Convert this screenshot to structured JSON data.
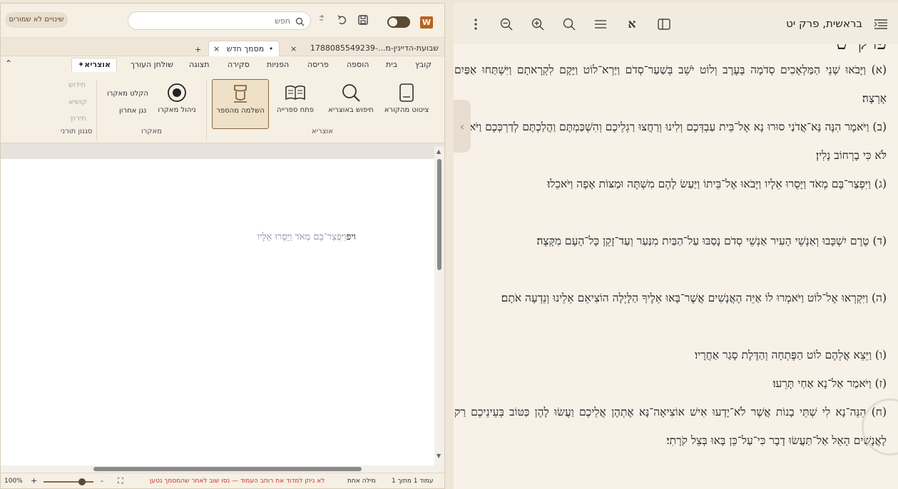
{
  "editor": {
    "unsaved_badge": "שינויים לא שמורים",
    "search_placeholder": "חפש",
    "tabs": [
      {
        "label": "שבועת-הדיינין-מ...-1788085549239"
      },
      {
        "label": "מסמך חדש",
        "dot": "•"
      }
    ],
    "tab_close": "×",
    "tab_add": "+",
    "menu": [
      "קובץ",
      "בית",
      "הוספה",
      "פריסה",
      "הפניות",
      "סקירה",
      "תצוגה",
      "שולחן העורך",
      "✦אוצריא"
    ],
    "ribbon": {
      "buttons": [
        "ציטוט מהקורא",
        "חיפוש באוצריא",
        "פתח ספרייה",
        "השלמה מהספר",
        "ניהול מאקרו"
      ],
      "small": [
        "הקלט מאקרו",
        "נגן אחרון",
        "חידוש",
        "קושיא",
        "תירוץ"
      ],
      "groups": [
        "אוצריא",
        "מאקרו",
        "סגנון תורני"
      ]
    },
    "document": {
      "typed": "ויפ",
      "suggestion": "וַיִּפְצַר־בָּם מְאֹד וַיָּסֻרוּ אֵלָיו"
    },
    "status": {
      "page": "עמוד 1 מתוך 1",
      "words": "מילה אחת",
      "warning": "לא ניתן למדוד את רוחב העמוד — נסו שוב לאחר שהמסמך נטען",
      "zoom": "100%",
      "plus": "+",
      "minus": "-"
    }
  },
  "reader": {
    "title": "בראשית, פרק יט",
    "chapter_heading": "פרק יט",
    "verses": [
      "(א) וַיָּבֹאוּ שְׁנֵי הַמַּלְאָכִים סְדֹמָה בָּעֶרֶב וְלוֹט יֹשֵׁב בְּשַׁעַר־סְדֹם וַיַּרְא־לוֹט וַיָּקָם לִקְרָאתָם וַיִּשְׁתַּחוּ אַפַּיִם אָרְצָה׃",
      "(ב) וַיֹּאמֶר הִנֶּה נָּא־אֲדֹנַי סוּרוּ נָא אֶל־בֵּית עַבְדְּכֶם וְלִינוּ וְרַחֲצוּ רַגְלֵיכֶם וְהִשְׁכַּמְתֶּם וַהֲלַכְתֶּם לְדַרְכְּכֶם וַיֹּאמְרוּ לֹּא כִּי בָרְחוֹב נָלִין׃",
      "(ג) וַיִּפְצַר־בָּם מְאֹד וַיָּסֻרוּ אֵלָיו וַיָּבֹאוּ אֶל־בֵּיתוֹ וַיַּעַשׂ לָהֶם מִשְׁתֶּה וּמַצּוֹת אָפָה וַיֹּאכֵלוּ׃",
      "(ד) טֶרֶם יִשְׁכָּבוּ וְאַנְשֵׁי הָעִיר אַנְשֵׁי סְדֹם נָסַבּוּ עַל־הַבַּיִת מִנַּעַר וְעַד־זָקֵן כָּל־הָעָם מִקָּצֶה׃",
      "(ה) וַיִּקְרְאוּ אֶל־לוֹט וַיֹּאמְרוּ לוֹ אַיֵּה הָאֲנָשִׁים אֲשֶׁר־בָּאוּ אֵלֶיךָ הַלָּיְלָה הוֹצִיאֵם אֵלֵינוּ וְנֵדְעָה אֹתָם׃",
      "(ו) וַיֵּצֵא אֲלֵהֶם לוֹט הַפֶּתְחָה וְהַדֶּלֶת סָגַר אַחֲרָיו׃",
      "(ז) וַיֹּאמַר אַל־נָא אַחַי תָּרֵעוּ׃",
      "(ח) הִנֵּה־נָא לִי שְׁתֵּי בָנוֹת אֲשֶׁר לֹא־יָדְעוּ אִישׁ אוֹצִיאָה־נָּא אֶתְהֶן אֲלֵיכֶם וַעֲשׂוּ לָהֶן כַּטּוֹב בְּעֵינֵיכֶם רַק לָאֲנָשִׁים הָאֵל אַל־תַּעֲשׂוּ דָבָר כִּי־עַל־כֵּן בָּאוּ בְּצֵל קֹרָתִי׃"
    ]
  },
  "colors": {
    "accent": "#8a6a44",
    "warning": "#c0392b",
    "word_icon": "#b9621c"
  },
  "icons": [
    "word-icon",
    "toggle",
    "save-icon",
    "undo-icon",
    "redo-icon",
    "search-icon",
    "menu-icon",
    "zoom-in-icon",
    "zoom-out-icon",
    "more-icon",
    "sidebar-icon",
    "font-icon",
    "book-icon",
    "library-icon",
    "quote-icon",
    "record-icon",
    "chevron-left-icon"
  ]
}
